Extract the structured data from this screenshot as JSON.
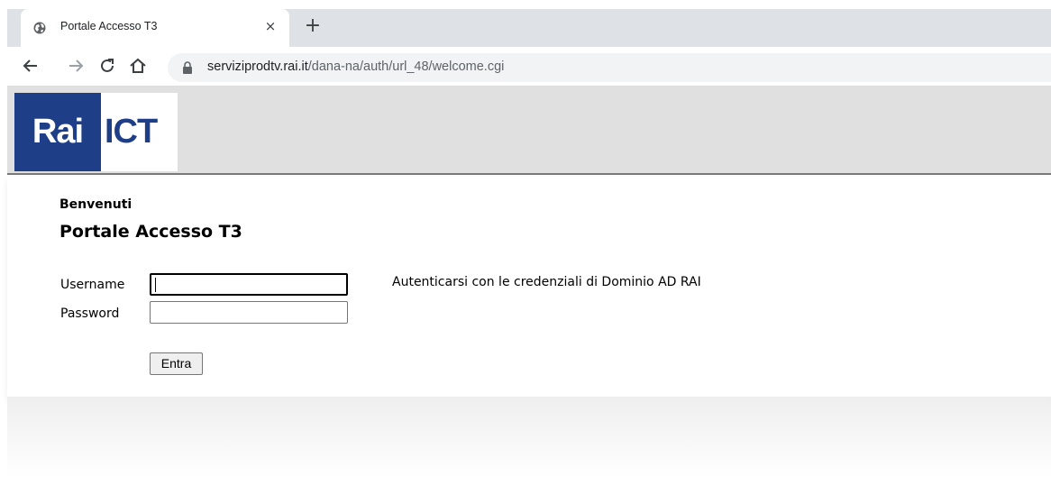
{
  "browser": {
    "tab_title": "Portale Accesso T3",
    "tab_close": "×",
    "new_tab": "+",
    "url_host": "serviziprodtv.rai.it",
    "url_path": "/dana-na/auth/url_48/welcome.cgi",
    "icons": [
      "back-arrow-icon",
      "forward-arrow-icon",
      "reload-icon",
      "home-icon",
      "lock-icon",
      "globe-icon"
    ]
  },
  "logo": {
    "brand": "Rai",
    "division": "ICT",
    "color": "#1e3f87"
  },
  "page": {
    "welcome": "Benvenuti",
    "title": "Portale Accesso T3",
    "hint": "Autenticarsi con le credenziali di Dominio AD RAI"
  },
  "form": {
    "username_label": "Username",
    "username_value": "",
    "password_label": "Password",
    "password_value": "",
    "submit_label": "Entra"
  }
}
